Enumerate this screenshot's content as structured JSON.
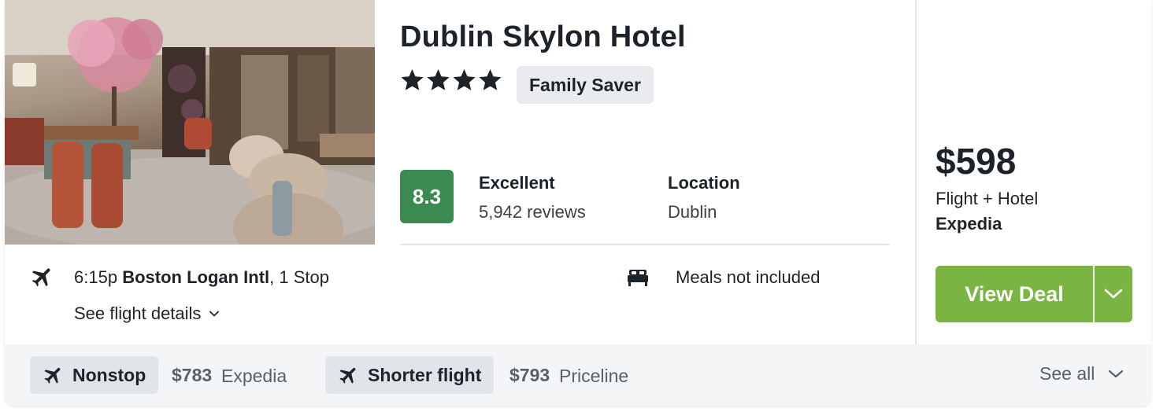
{
  "hotel": {
    "name": "Dublin Skylon Hotel",
    "star_rating": 4,
    "badge": "Family Saver",
    "score": "8.3",
    "score_color": "#3a8a52",
    "rating_label": "Excellent",
    "reviews": "5,942 reviews",
    "location_label": "Location",
    "location": "Dublin"
  },
  "flight": {
    "time": "6:15p",
    "airport": "Boston Logan Intl",
    "stops": ", 1 Stop",
    "details_link": "See flight details",
    "meals": "Meals not included"
  },
  "pricing": {
    "price": "$598",
    "type": "Flight + Hotel",
    "provider": "Expedia",
    "cta": "View Deal",
    "cta_color": "#7ab443"
  },
  "alternatives": [
    {
      "label": "Nonstop",
      "price": "$783",
      "provider": "Expedia"
    },
    {
      "label": "Shorter flight",
      "price": "$793",
      "provider": "Priceline"
    }
  ],
  "footer": {
    "see_all": "See all"
  },
  "icons": {
    "star": "star-icon",
    "plane": "airplane-icon",
    "bed": "bed-icon",
    "chevron": "chevron-down-icon"
  }
}
